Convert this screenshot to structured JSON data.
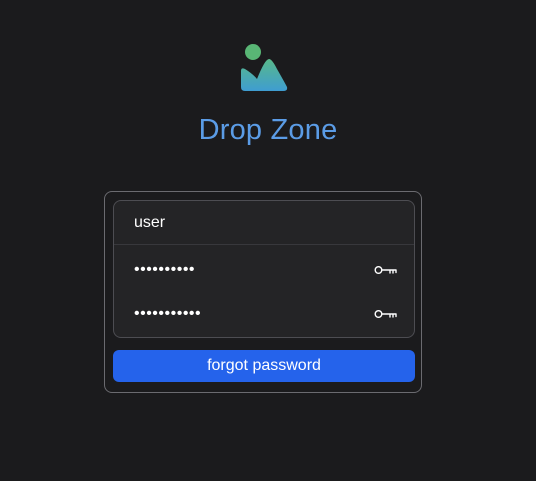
{
  "app": {
    "title": "Drop Zone",
    "logo_icon": "image-landscape-icon",
    "accent_color": "#5b9ce6"
  },
  "form": {
    "username_value": "user",
    "password_value": "••••••••••",
    "confirm_password_value": "•••••••••••",
    "password_icon": "key-icon",
    "forgot_button_label": "forgot password",
    "button_color": "#2563eb"
  }
}
